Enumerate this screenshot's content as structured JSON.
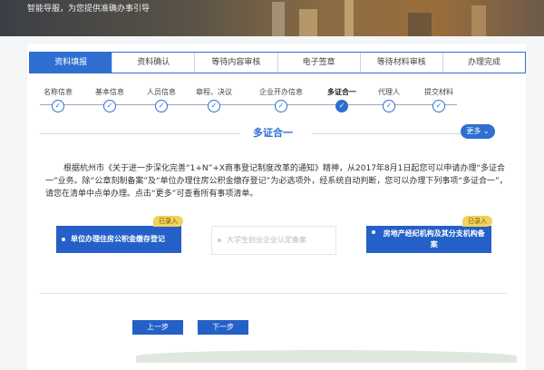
{
  "banner": {
    "tagline": "智能导服，为您提供准确办事引导"
  },
  "steps": [
    {
      "label": "资料填报",
      "active": true
    },
    {
      "label": "资料确认",
      "active": false
    },
    {
      "label": "等待内容审核",
      "active": false
    },
    {
      "label": "电子签章",
      "active": false
    },
    {
      "label": "等待材料审核",
      "active": false
    },
    {
      "label": "办理完成",
      "active": false
    }
  ],
  "substeps": [
    {
      "label": "名称信息",
      "current": false
    },
    {
      "label": "基本信息",
      "current": false
    },
    {
      "label": "人员信息",
      "current": false
    },
    {
      "label": "章程、决议",
      "current": false
    },
    {
      "label": "企业开办信息",
      "current": false
    },
    {
      "label": "多证合一",
      "current": true
    },
    {
      "label": "代理人",
      "current": false
    },
    {
      "label": "提交材料",
      "current": false
    }
  ],
  "section": {
    "title": "多证合一",
    "more_label": "更多 ⌄"
  },
  "description": "根据杭州市《关于进一步深化完善“1+N”+X商事登记制度改革的通知》精神，从2017年8月1日起您可以申请办理“多证合一”业务。除“公章刻制备案”及“单位办理住房公积金缴存登记”为必选项外，经系统自动判断，您可以办理下列事项“多证合一”，请您在清单中点单办理。点击“更多”可查看所有事项清单。",
  "options": {
    "housing_fund": {
      "label": "单位办理住房公积金缴存登记",
      "badge": "已录入"
    },
    "startup": {
      "label": "大学生创业企业认定备案"
    },
    "real_estate": {
      "label": "房地产经纪机构及其分支机构备案",
      "badge": "已录入"
    }
  },
  "nav": {
    "prev_label": "上一步",
    "next_label": "下一步"
  },
  "colors": {
    "primary": "#2460c8",
    "badge": "#f2d15c"
  }
}
